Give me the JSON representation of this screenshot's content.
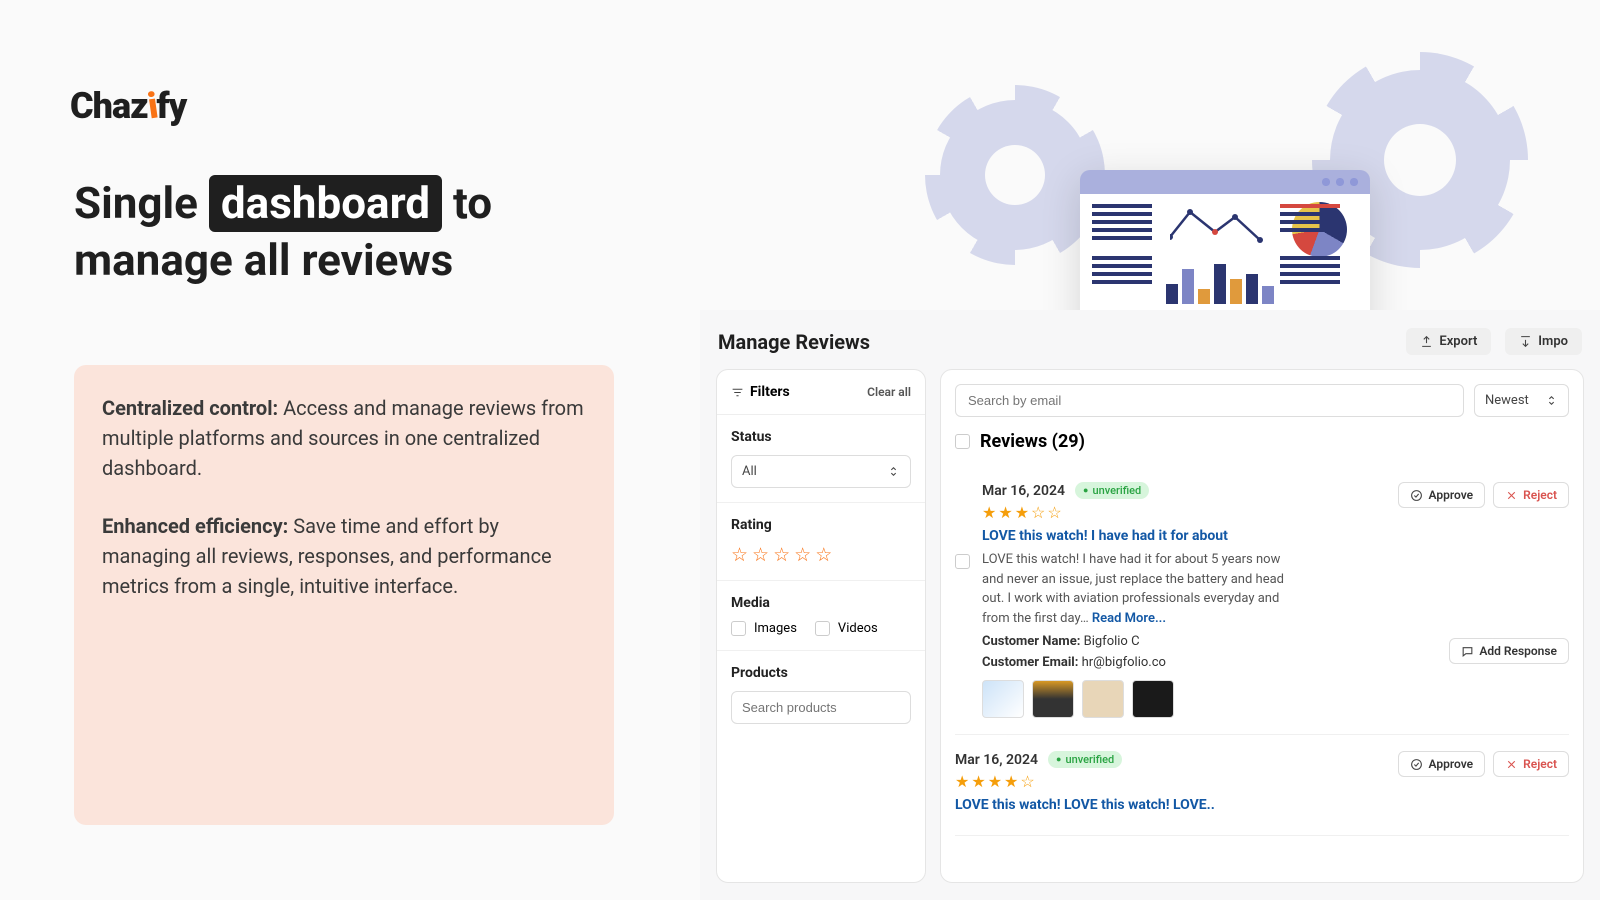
{
  "brand": {
    "name_pre": "Chaz",
    "name_accent": "i",
    "name_post": "fy"
  },
  "headline": {
    "pre": "Single ",
    "highlight": "dashboard",
    "post1": " to",
    "post2": "manage all reviews"
  },
  "info": [
    {
      "label": "Centralized control:",
      "text": " Access and manage reviews from multiple platforms and sources in one centralized dashboard."
    },
    {
      "label": "Enhanced efficiency:",
      "text": " Save time and effort by managing all reviews, responses, and performance metrics from a single, intuitive interface."
    }
  ],
  "dashboard": {
    "title": "Manage Reviews",
    "export_label": "Export",
    "import_label": "Impo",
    "filters": {
      "title": "Filters",
      "clear": "Clear all",
      "status_label": "Status",
      "status_value": "All",
      "rating_label": "Rating",
      "media_label": "Media",
      "media_images": "Images",
      "media_videos": "Videos",
      "products_label": "Products",
      "products_placeholder": "Search products"
    },
    "search_placeholder": "Search by email",
    "sort_value": "Newest",
    "reviews_count": "Reviews (29)",
    "approve": "Approve",
    "reject": "Reject",
    "add_response": "Add Response",
    "read_more": "Read More...",
    "reviews": [
      {
        "date": "Mar 16, 2024",
        "badge": "unverified",
        "stars": "★★★☆☆",
        "title": "LOVE this watch! I have had it for about",
        "text": "LOVE this watch! I have had it for about 5 years now and never an issue, just replace the battery and head out. I work with aviation professionals everyday and from the first day…",
        "name_label": "Customer Name:",
        "name_val": " Bigfolio C",
        "email_label": "Customer Email:",
        "email_val": " hr@bigfolio.co"
      },
      {
        "date": "Mar 16, 2024",
        "badge": "unverified",
        "stars": "★★★★☆",
        "title": "LOVE this watch! LOVE this watch! LOVE.."
      }
    ]
  }
}
